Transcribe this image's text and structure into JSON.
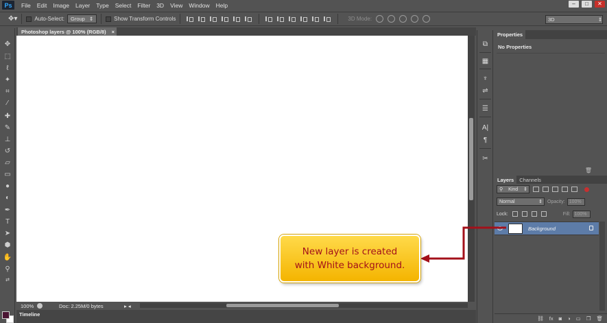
{
  "app": {
    "logo": "Ps"
  },
  "menu": [
    "File",
    "Edit",
    "Image",
    "Layer",
    "Type",
    "Select",
    "Filter",
    "3D",
    "View",
    "Window",
    "Help"
  ],
  "options_bar": {
    "auto_select_label": "Auto-Select:",
    "auto_select_value": "Group",
    "show_transform_label": "Show Transform Controls",
    "mode3d_label": "3D Mode:",
    "workspace": "3D"
  },
  "document": {
    "tab_title": "Photoshop layers @ 100% (RGB/8)",
    "zoom": "100%",
    "doc_info": "Doc: 2.25M/0 bytes",
    "timeline_label": "Timeline"
  },
  "properties": {
    "tab_label": "Properties",
    "empty_text": "No Properties"
  },
  "layers": {
    "tab_label": "Layers",
    "channels_label": "Channels",
    "kind_label": "Kind",
    "blend_mode": "Normal",
    "opacity_label": "Opacity:",
    "opacity_value": "100%",
    "lock_label": "Lock:",
    "fill_label": "Fill:",
    "fill_value": "100%",
    "layer_name": "Background"
  },
  "callout": {
    "line1": "New layer is created",
    "line2": "with White background."
  },
  "colors": {
    "foreground": "#4a1533",
    "background": "#ffffff",
    "arrow": "#a3101a",
    "selected_layer": "#5d7ca8"
  }
}
